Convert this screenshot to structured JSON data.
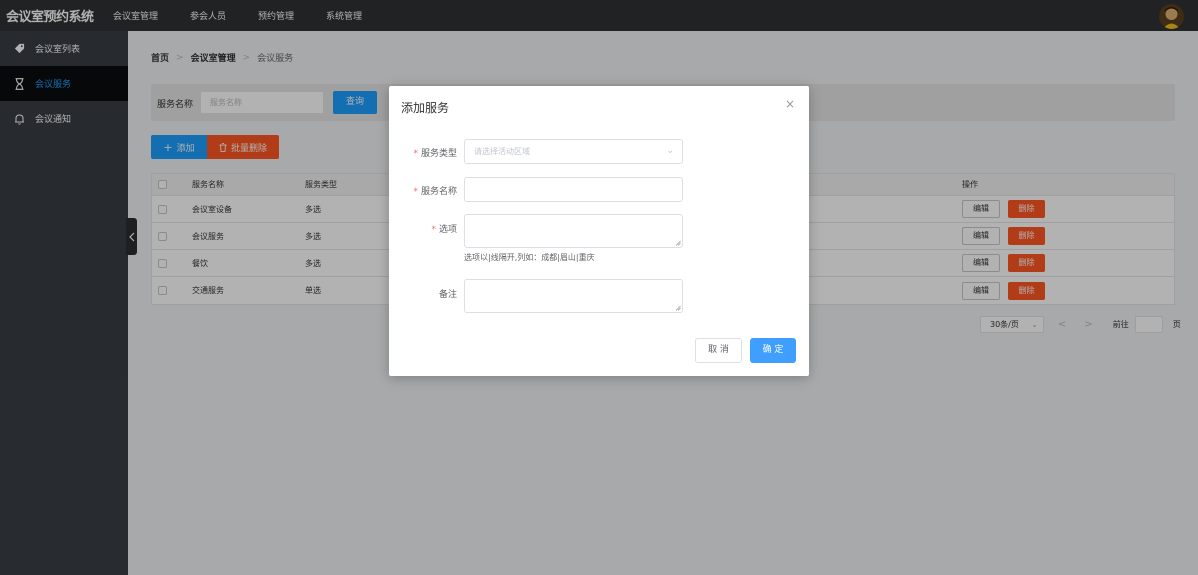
{
  "app": {
    "title": "会议室预约系统"
  },
  "topnav": {
    "items": [
      "会议室管理",
      "参会人员",
      "预约管理",
      "系统管理"
    ]
  },
  "sidebar": {
    "items": [
      {
        "label": "会议室列表",
        "icon": "tag-icon"
      },
      {
        "label": "会议服务",
        "icon": "hourglass-icon",
        "active": true
      },
      {
        "label": "会议通知",
        "icon": "bell-icon"
      }
    ]
  },
  "breadcrumb": {
    "items": [
      "首页",
      "会议室管理",
      "会议服务"
    ],
    "separator": ">"
  },
  "search": {
    "label": "服务名称",
    "placeholder": "服务名称",
    "button": "查询"
  },
  "toolbar": {
    "add_label": "添加",
    "batch_delete_label": "批量删除"
  },
  "table": {
    "headers": {
      "name": "服务名称",
      "type": "服务类型",
      "op": "操作"
    },
    "rows": [
      {
        "name": "会议室设备",
        "type": "多选"
      },
      {
        "name": "会议服务",
        "type": "多选"
      },
      {
        "name": "餐饮",
        "type": "多选"
      },
      {
        "name": "交通服务",
        "type": "单选"
      }
    ],
    "edit_label": "编辑",
    "delete_label": "删除"
  },
  "pagination": {
    "page_size": "30条/页",
    "prev": "<",
    "next": ">",
    "goto_label": "前往",
    "page_unit": "页"
  },
  "modal": {
    "title": "添加服务",
    "close": "×",
    "required_mark": "*",
    "fields": {
      "type_label": "服务类型",
      "type_placeholder": "请选择活动区域",
      "name_label": "服务名称",
      "options_label": "选项",
      "options_hint": "选项以|线隔开,列如：成都|眉山|重庆",
      "remark_label": "备注"
    },
    "cancel": "取 消",
    "confirm": "确 定"
  },
  "colors": {
    "topbar": "#2f3234",
    "sidebar": "#393d44",
    "sidebar_active_bg": "#0b0c0d",
    "accent": "#1e9fff",
    "danger": "#ff5722",
    "confirm": "#409eff"
  }
}
